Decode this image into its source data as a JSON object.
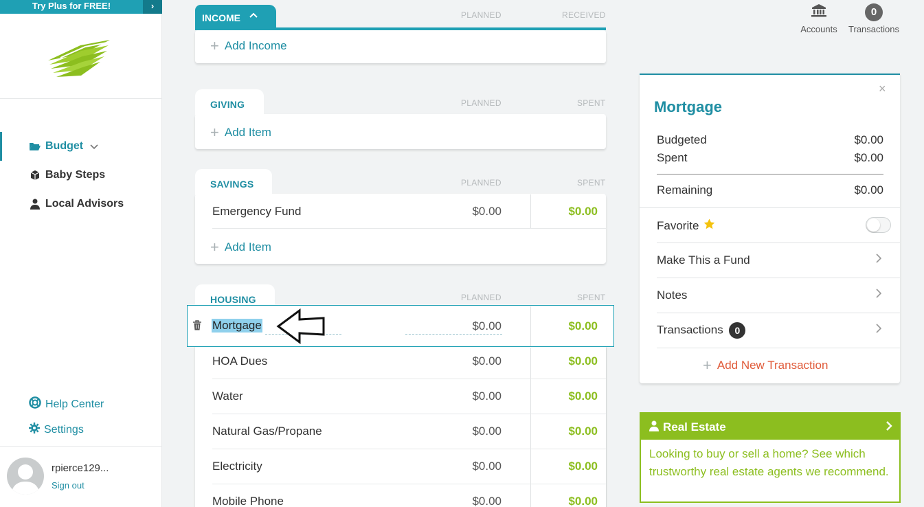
{
  "sidebar": {
    "promo_label": "Try Plus for FREE!",
    "promo_arrow": "›",
    "nav": {
      "budget": "Budget",
      "baby_steps": "Baby Steps",
      "local_advisors": "Local Advisors"
    },
    "help_center": "Help Center",
    "settings": "Settings",
    "user": {
      "name": "rpierce129...",
      "sign_out": "Sign out"
    }
  },
  "groups": {
    "income": {
      "title": "INCOME",
      "planned_head": "PLANNED",
      "received_head": "RECEIVED",
      "add_label": "Add Income"
    },
    "giving": {
      "title": "GIVING",
      "planned_head": "PLANNED",
      "spent_head": "SPENT",
      "add_label": "Add Item"
    },
    "savings": {
      "title": "SAVINGS",
      "planned_head": "PLANNED",
      "spent_head": "SPENT",
      "add_label": "Add Item",
      "rows": [
        {
          "name": "Emergency Fund",
          "planned": "$0.00",
          "spent": "$0.00"
        }
      ]
    },
    "housing": {
      "title": "HOUSING",
      "planned_head": "PLANNED",
      "spent_head": "SPENT",
      "editing_row": {
        "name": "Mortgage",
        "planned": "$0.00",
        "spent": "$0.00"
      },
      "rows": [
        {
          "name": "HOA Dues",
          "planned": "$0.00",
          "spent": "$0.00"
        },
        {
          "name": "Water",
          "planned": "$0.00",
          "spent": "$0.00"
        },
        {
          "name": "Natural Gas/Propane",
          "planned": "$0.00",
          "spent": "$0.00"
        },
        {
          "name": "Electricity",
          "planned": "$0.00",
          "spent": "$0.00"
        },
        {
          "name": "Mobile Phone",
          "planned": "$0.00",
          "spent": "$0.00"
        }
      ]
    }
  },
  "topbar": {
    "accounts_label": "Accounts",
    "transactions_label": "Transactions",
    "transactions_count": "0"
  },
  "detail": {
    "title": "Mortgage",
    "close": "×",
    "budgeted_label": "Budgeted",
    "budgeted_value": "$0.00",
    "spent_label": "Spent",
    "spent_value": "$0.00",
    "remaining_label": "Remaining",
    "remaining_value": "$0.00",
    "favorite_label": "Favorite",
    "fund_label": "Make This a Fund",
    "notes_label": "Notes",
    "transactions_label": "Transactions",
    "transactions_count": "0",
    "add_transaction": "Add New Transaction"
  },
  "real_estate": {
    "title": "Real Estate",
    "body": "Looking to buy or sell a home? See which trustworthy real estate agents we recommend."
  },
  "colors": {
    "teal": "#1f8ea3",
    "green": "#8cbe1f",
    "red": "#e05b3a"
  }
}
